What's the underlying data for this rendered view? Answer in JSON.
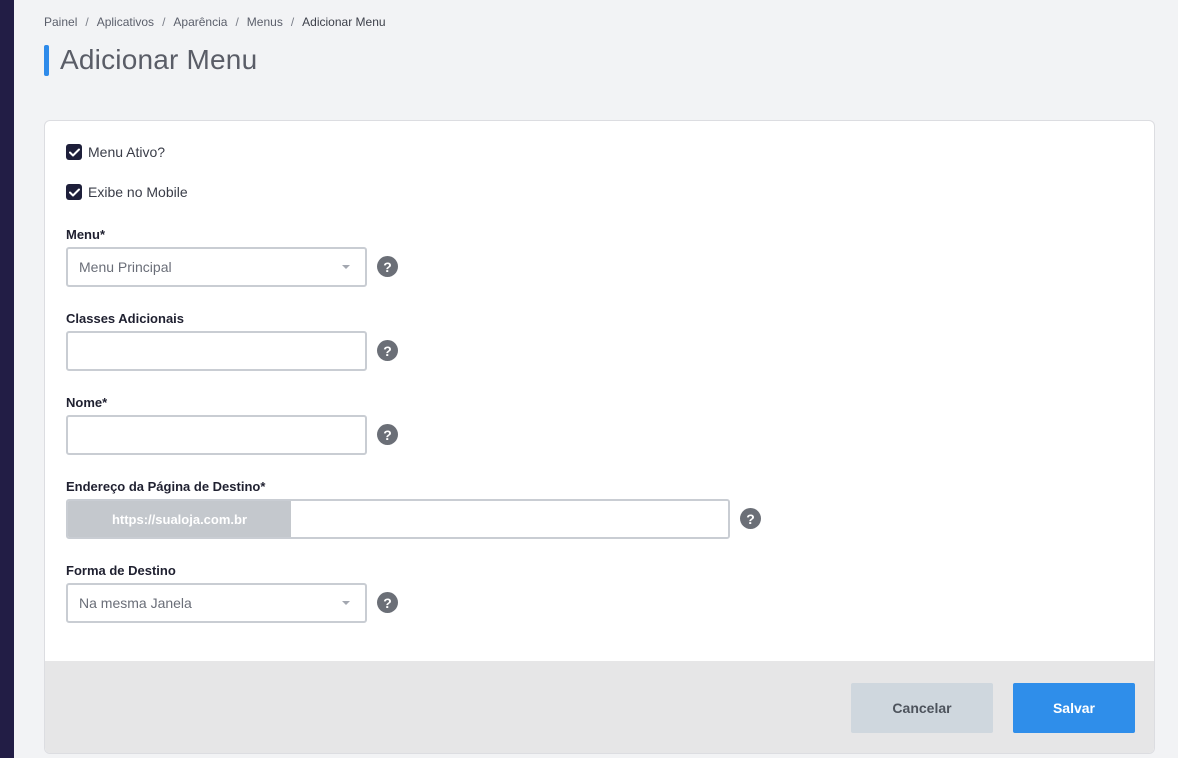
{
  "breadcrumb": {
    "items": [
      "Painel",
      "Aplicativos",
      "Aparência",
      "Menus",
      "Adicionar Menu"
    ],
    "separator": "/"
  },
  "page_title": "Adicionar Menu",
  "form": {
    "menu_ativo": {
      "label": "Menu Ativo?",
      "checked": true
    },
    "exibe_mobile": {
      "label": "Exibe no Mobile",
      "checked": true
    },
    "menu": {
      "label": "Menu*",
      "value": "Menu Principal"
    },
    "classes": {
      "label": "Classes Adicionais",
      "value": ""
    },
    "nome": {
      "label": "Nome*",
      "value": ""
    },
    "endereco": {
      "label": "Endereço da Página de Destino*",
      "prefix": "https://sualoja.com.br",
      "value": ""
    },
    "forma_destino": {
      "label": "Forma de Destino",
      "value": "Na mesma Janela"
    },
    "help_glyph": "?"
  },
  "footer": {
    "cancel_label": "Cancelar",
    "save_label": "Salvar"
  },
  "colors": {
    "accent": "#2e8bea",
    "save_button": "#2f8eea",
    "cancel_button": "#cfd7de",
    "checkbox": "#1e1f3a",
    "sidebar": "#221d45"
  },
  "icons": [
    "check-icon",
    "chevron-down-icon",
    "help-icon"
  ]
}
